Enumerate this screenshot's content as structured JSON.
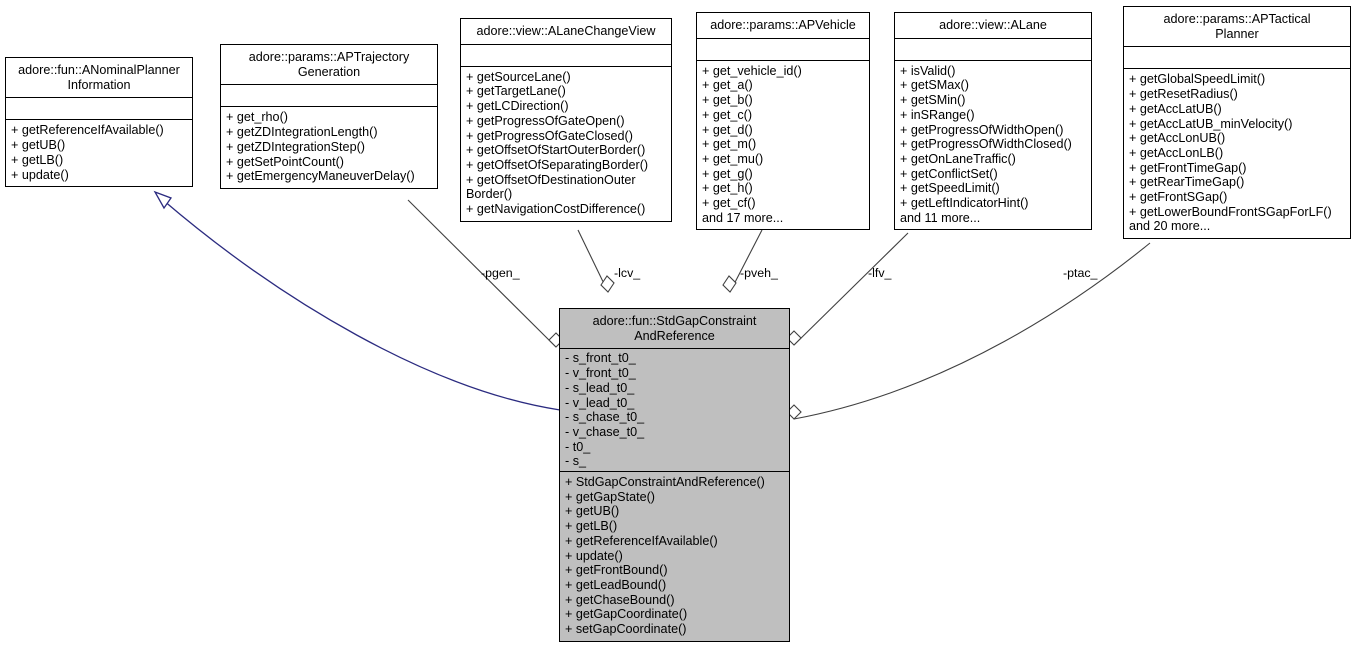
{
  "diagram": {
    "type": "uml-class-collaboration-diagram",
    "accent_highlight_color": "#bfbfbf",
    "inheritance_edge_color": "#2b2b80",
    "association_edge_color": "#404040",
    "background_color": "#ffffff"
  },
  "classes": [
    {
      "id": "anominalplannerinformation",
      "title": "adore::fun::ANominalPlanner\nInformation",
      "attributes": [],
      "operations": [
        "+ getReferenceIfAvailable()",
        "+ getUB()",
        "+ getLB()",
        "+ update()"
      ],
      "highlight": false
    },
    {
      "id": "aptrajectorygeneration",
      "title": "adore::params::APTrajectory\nGeneration",
      "attributes": [],
      "operations": [
        "+ get_rho()",
        "+ getZDIntegrationLength()",
        "+ getZDIntegrationStep()",
        "+ getSetPointCount()",
        "+ getEmergencyManeuverDelay()"
      ],
      "highlight": false
    },
    {
      "id": "alanechangeview",
      "title": "adore::view::ALaneChangeView",
      "attributes": [],
      "operations": [
        "+ getSourceLane()",
        "+ getTargetLane()",
        "+ getLCDirection()",
        "+ getProgressOfGateOpen()",
        "+ getProgressOfGateClosed()",
        "+ getOffsetOfStartOuterBorder()",
        "+ getOffsetOfSeparatingBorder()",
        "+ getOffsetOfDestinationOuter Border()",
        "+ getNavigationCostDifference()"
      ],
      "highlight": false
    },
    {
      "id": "apvehicle",
      "title": "adore::params::APVehicle",
      "attributes": [],
      "operations": [
        "+ get_vehicle_id()",
        "+ get_a()",
        "+ get_b()",
        "+ get_c()",
        "+ get_d()",
        "+ get_m()",
        "+ get_mu()",
        "+ get_g()",
        "+ get_h()",
        "+ get_cf()",
        "and 17 more..."
      ],
      "highlight": false
    },
    {
      "id": "alane",
      "title": "adore::view::ALane",
      "attributes": [],
      "operations": [
        "+ isValid()",
        "+ getSMax()",
        "+ getSMin()",
        "+ inSRange()",
        "+ getProgressOfWidthOpen()",
        "+ getProgressOfWidthClosed()",
        "+ getOnLaneTraffic()",
        "+ getConflictSet()",
        "+ getSpeedLimit()",
        "+ getLeftIndicatorHint()",
        "and 11 more..."
      ],
      "highlight": false
    },
    {
      "id": "aptacticalplanner",
      "title": "adore::params::APTactical\nPlanner",
      "attributes": [],
      "operations": [
        "+ getGlobalSpeedLimit()",
        "+ getResetRadius()",
        "+ getAccLatUB()",
        "+ getAccLatUB_minVelocity()",
        "+ getAccLonUB()",
        "+ getAccLonLB()",
        "+ getFrontTimeGap()",
        "+ getRearTimeGap()",
        "+ getFrontSGap()",
        "+ getLowerBoundFrontSGapForLF()",
        "and 20 more..."
      ],
      "highlight": false
    },
    {
      "id": "stdgapconstraintandreference",
      "title": "adore::fun::StdGapConstraint\nAndReference",
      "attributes": [
        "- s_front_t0_",
        "- v_front_t0_",
        "- s_lead_t0_",
        "- v_lead_t0_",
        "- s_chase_t0_",
        "- v_chase_t0_",
        "- t0_",
        "- s_"
      ],
      "operations": [
        "+ StdGapConstraintAndReference()",
        "+ getGapState()",
        "+ getUB()",
        "+ getLB()",
        "+ getReferenceIfAvailable()",
        "+ update()",
        "+ getFrontBound()",
        "+ getLeadBound()",
        "+ getChaseBound()",
        "+ getGapCoordinate()",
        "+ setGapCoordinate()"
      ],
      "highlight": true
    }
  ],
  "edge_labels": [
    {
      "id": "pgen",
      "text": "-pgen_"
    },
    {
      "id": "lcv",
      "text": "-lcv_"
    },
    {
      "id": "pveh",
      "text": "-pveh_"
    },
    {
      "id": "lfv",
      "text": "-lfv_"
    },
    {
      "id": "ptac",
      "text": "-ptac_"
    }
  ]
}
